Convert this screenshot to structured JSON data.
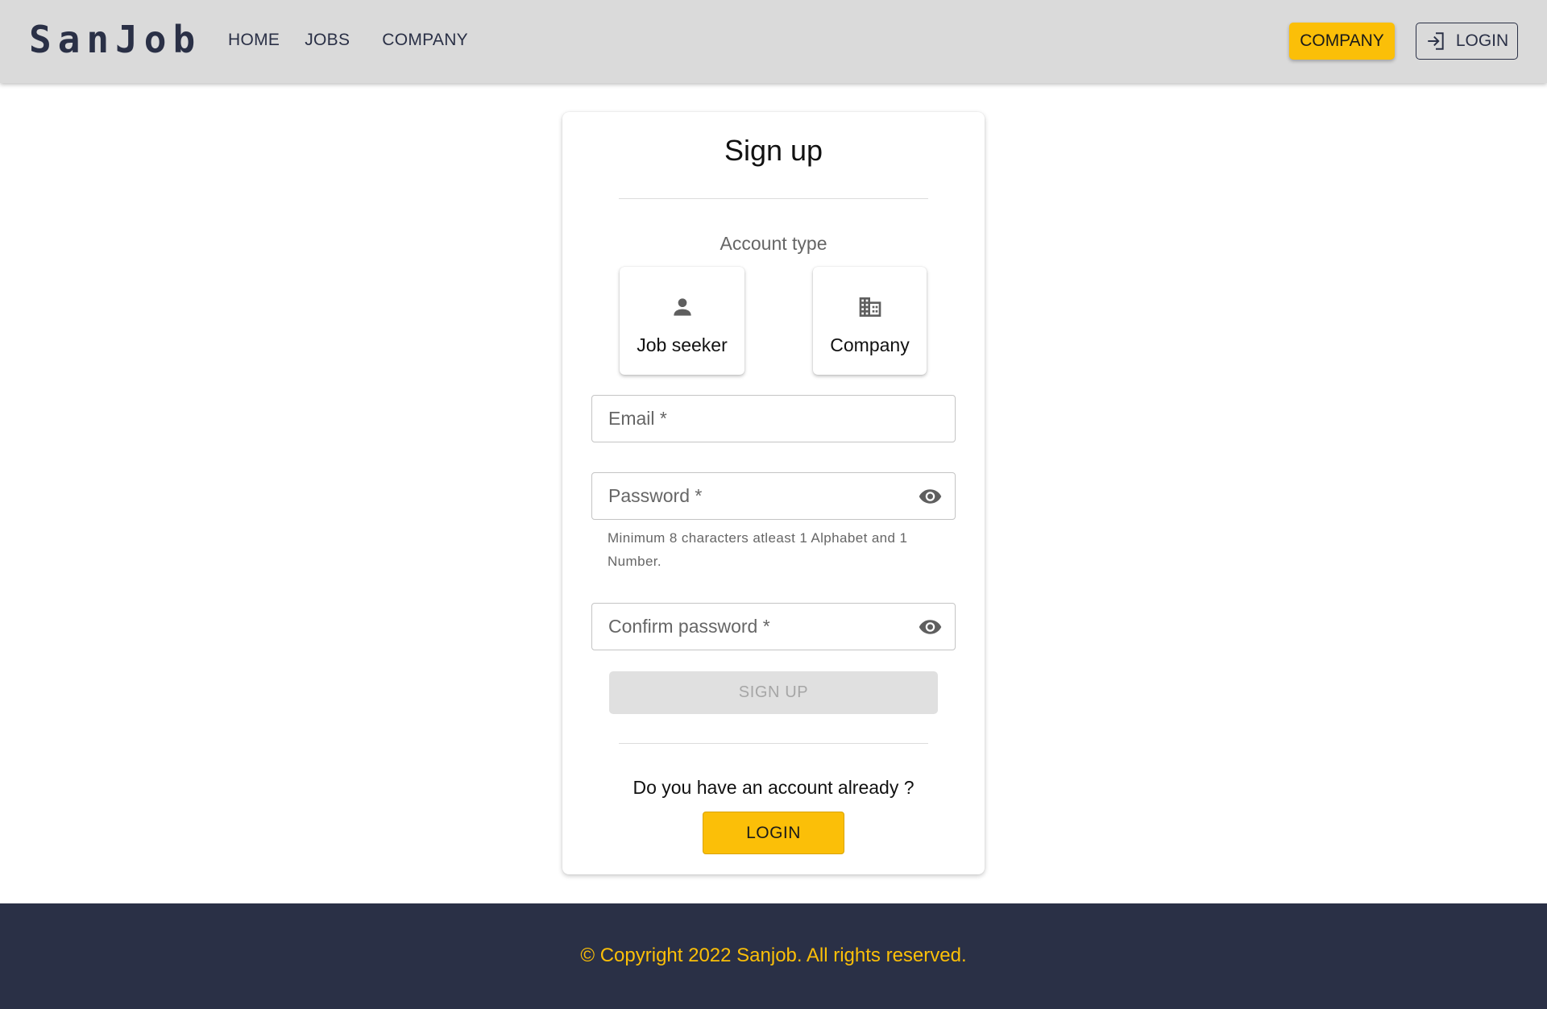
{
  "header": {
    "logo": "SanJob",
    "nav": [
      "HOME",
      "JOBS",
      "COMPANY"
    ],
    "company_button": "COMPANY",
    "login_button": "LOGIN",
    "login_icon": "login-icon"
  },
  "signup": {
    "title": "Sign up",
    "account_type_label": "Account type",
    "account_types": [
      {
        "label": "Job seeker",
        "icon": "person-icon"
      },
      {
        "label": "Company",
        "icon": "building-icon"
      }
    ],
    "email_placeholder": "Email *",
    "password_placeholder": "Password *",
    "password_helper": "Minimum 8 characters atleast 1 Alphabet and 1 Number.",
    "confirm_placeholder": "Confirm password *",
    "submit_label": "SIGN UP",
    "already_text": "Do you have an account already ?",
    "login_label": "LOGIN"
  },
  "footer": {
    "copyright": "© Copyright 2022 Sanjob. All rights reserved."
  },
  "colors": {
    "header_bg": "#dadada",
    "brand_dark": "#2a3046",
    "accent_yellow": "#fbbf08",
    "disabled_bg": "#e0e0e0"
  }
}
